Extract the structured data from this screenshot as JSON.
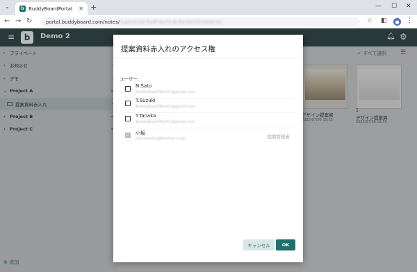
{
  "browser": {
    "tab_title": "BuddyBoardPortal",
    "url_visible": "portal.buddyboard.com/notes/",
    "url_blurred": "1a2b3c4d-5e6f-4a7b-8c9d-0e1f2a3b4c5d"
  },
  "app": {
    "title": "Demo 2",
    "select_all": "すべて選択"
  },
  "sidebar": {
    "items": [
      {
        "label": "プライベート"
      },
      {
        "label": "お知らせ"
      },
      {
        "label": "デモ"
      },
      {
        "label": "Project A"
      },
      {
        "label": "提案資料赤入れ"
      },
      {
        "label": "Project B"
      },
      {
        "label": "Project C"
      }
    ],
    "add_label": "追加"
  },
  "thumbnails": [
    {
      "name": "デザイン提案資",
      "date": "2023/07/06 19:55"
    },
    {
      "number": "5",
      "name": "デザイン提案資",
      "date": "2023/07/06 19:55"
    }
  ],
  "dialog": {
    "title": "提案資料赤入れのアクセス権",
    "users_label": "ユーザー",
    "users": [
      {
        "name": "N.Sato",
        "email": "BuddyBoardTest01@gmail.com",
        "checked": false,
        "role": ""
      },
      {
        "name": "T.Suzuki",
        "email": "BuddyBoardTest01@gmail.com",
        "checked": false,
        "role": ""
      },
      {
        "name": "Y.Tanaka",
        "email": "BuddyBoardTest01@gmail.com",
        "checked": false,
        "role": ""
      },
      {
        "name": "小坂",
        "email": "taro.kosaka@brother.co.jp",
        "checked": true,
        "role": "組織管理者"
      }
    ],
    "cancel_label": "キャンセル",
    "ok_label": "OK"
  },
  "colors": {
    "brand": "#1f6f6c",
    "appbar": "#1c3836"
  }
}
